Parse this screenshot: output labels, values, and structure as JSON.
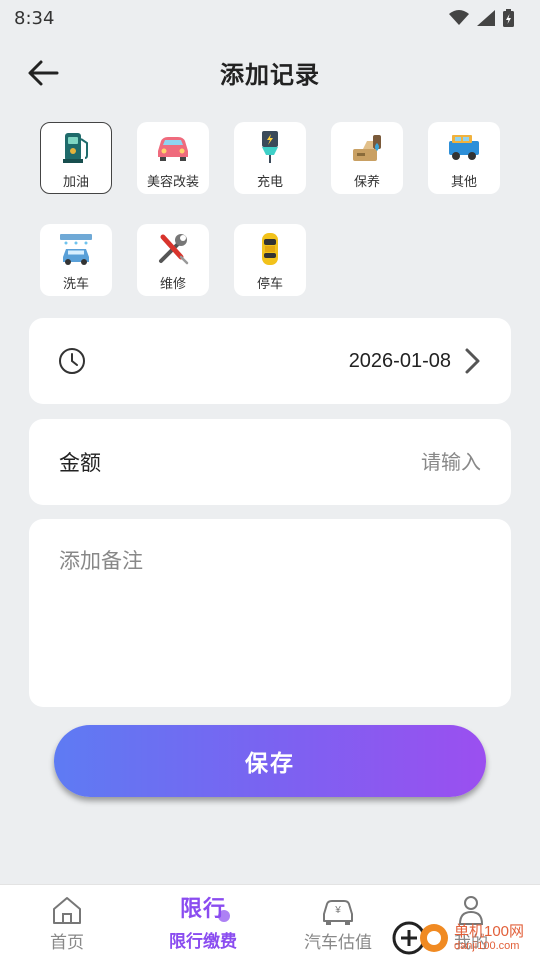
{
  "status_bar": {
    "time": "8:34",
    "icons": [
      "wifi-icon",
      "signal-icon",
      "battery-charging-icon"
    ]
  },
  "header": {
    "title": "添加记录",
    "back_icon": "arrow-left-icon"
  },
  "categories": [
    {
      "label": "加油",
      "icon": "fuel-pump-icon",
      "selected": true
    },
    {
      "label": "美容改装",
      "icon": "pink-car-icon",
      "selected": false
    },
    {
      "label": "充电",
      "icon": "charger-plug-icon",
      "selected": false
    },
    {
      "label": "保养",
      "icon": "oil-can-icon",
      "selected": false
    },
    {
      "label": "其他",
      "icon": "blue-truck-icon",
      "selected": false
    },
    {
      "label": "洗车",
      "icon": "car-wash-icon",
      "selected": false
    },
    {
      "label": "维修",
      "icon": "wrench-screwdriver-icon",
      "selected": false
    },
    {
      "label": "停车",
      "icon": "yellow-car-topview-icon",
      "selected": false
    }
  ],
  "date_row": {
    "value": "2026-01-08",
    "icon": "clock-icon"
  },
  "amount_row": {
    "label": "金额",
    "placeholder": "请输入"
  },
  "note": {
    "placeholder": "添加备注"
  },
  "save_button": {
    "label": "保存"
  },
  "tab_bar": {
    "tabs": [
      {
        "label": "首页",
        "icon": "home-icon",
        "active": false
      },
      {
        "label": "限行缴费",
        "icon_text": "限行",
        "active": true
      },
      {
        "label": "汽车估值",
        "icon": "car-yen-icon",
        "active": false
      },
      {
        "label": "我的",
        "icon": "person-icon",
        "active": false
      }
    ]
  },
  "watermark": {
    "text": "单机100网",
    "url_text": "danji100.com"
  },
  "colors": {
    "background": "#eceef0",
    "accent": "#8a4cf0",
    "button_gradient_start": "#5e7bf3",
    "button_gradient_end": "#9b4ff0"
  }
}
